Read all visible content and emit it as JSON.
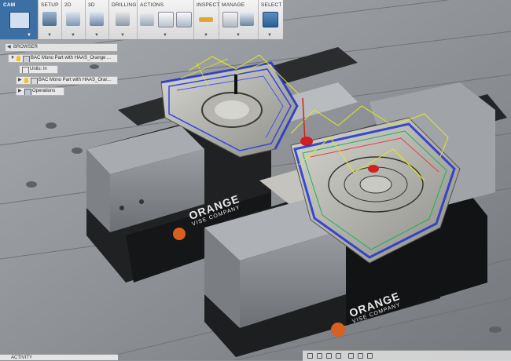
{
  "toolbar": {
    "workspace": "CAM",
    "groups": [
      "SETUP",
      "2D",
      "3D",
      "DRILLING",
      "ACTIONS",
      "INSPECT",
      "MANAGE",
      "SELECT"
    ]
  },
  "browser": {
    "title": "BROWSER",
    "items": [
      {
        "label": "BAC Mono Part with HAAS_Orange ..."
      },
      {
        "label": "Units: in"
      },
      {
        "label": "BAC Mono Part with HAAS_Orar..."
      },
      {
        "label": "Operations"
      }
    ]
  },
  "scene": {
    "vise_brand": "ORANGE",
    "vise_company": "VISE COMPANY"
  },
  "status": {
    "activity": "ACTIVITY"
  },
  "colors": {
    "accent": "#2a6fb0",
    "orange": "#e8762b",
    "toolpath_blue": "#2233cc",
    "toolpath_yellow": "#e6e620"
  }
}
